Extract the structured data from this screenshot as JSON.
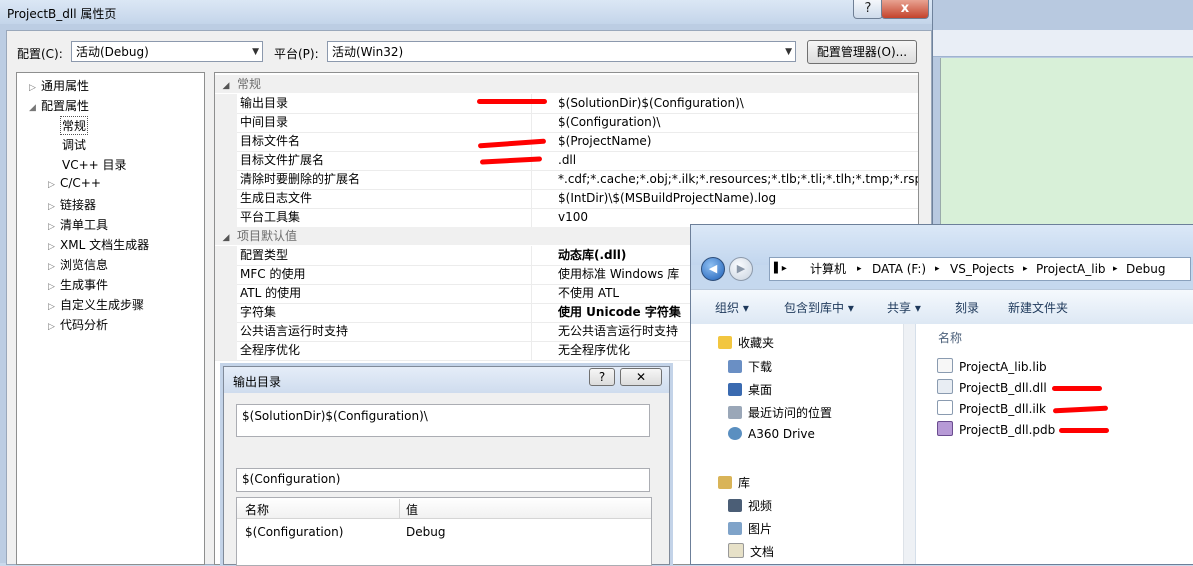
{
  "window": {
    "title": "ProjectB_dll 属性页",
    "help_btn": "?",
    "close_btn": "x"
  },
  "top": {
    "config_label": "配置(C):",
    "config_value": "活动(Debug)",
    "platform_label": "平台(P):",
    "platform_value": "活动(Win32)",
    "config_manager": "配置管理器(O)..."
  },
  "tree": [
    {
      "label": "通用属性",
      "expander": "▷"
    },
    {
      "label": "配置属性",
      "expander": "◢"
    },
    {
      "label": "常规",
      "expander": ""
    },
    {
      "label": "调试",
      "expander": ""
    },
    {
      "label": "VC++ 目录",
      "expander": ""
    },
    {
      "label": "C/C++",
      "expander": "▷"
    },
    {
      "label": "链接器",
      "expander": "▷"
    },
    {
      "label": "清单工具",
      "expander": "▷"
    },
    {
      "label": "XML 文档生成器",
      "expander": "▷"
    },
    {
      "label": "浏览信息",
      "expander": "▷"
    },
    {
      "label": "生成事件",
      "expander": "▷"
    },
    {
      "label": "自定义生成步骤",
      "expander": "▷"
    },
    {
      "label": "代码分析",
      "expander": "▷"
    }
  ],
  "grid": {
    "cat_general": "常规",
    "cat_defaults": "项目默认值",
    "expander": "◢",
    "general": [
      {
        "name": "输出目录",
        "value": "$(SolutionDir)$(Configuration)\\"
      },
      {
        "name": "中间目录",
        "value": "$(Configuration)\\"
      },
      {
        "name": "目标文件名",
        "value": "$(ProjectName)"
      },
      {
        "name": "目标文件扩展名",
        "value": ".dll"
      },
      {
        "name": "清除时要删除的扩展名",
        "value": "*.cdf;*.cache;*.obj;*.ilk;*.resources;*.tlb;*.tli;*.tlh;*.tmp;*.rsp;*.pgc"
      },
      {
        "name": "生成日志文件",
        "value": "$(IntDir)\\$(MSBuildProjectName).log"
      },
      {
        "name": "平台工具集",
        "value": "v100"
      }
    ],
    "defaults": [
      {
        "name": "配置类型",
        "value": "动态库(.dll)"
      },
      {
        "name": "MFC 的使用",
        "value": "使用标准 Windows 库"
      },
      {
        "name": "ATL 的使用",
        "value": "不使用 ATL"
      },
      {
        "name": "字符集",
        "value": "使用 Unicode 字符集"
      },
      {
        "name": "公共语言运行时支持",
        "value": "无公共语言运行时支持"
      },
      {
        "name": "全程序优化",
        "value": "无全程序优化"
      }
    ]
  },
  "subdialog": {
    "title": "输出目录",
    "help_btn": "?",
    "close_btn": "✕",
    "edit_value": "$(SolutionDir)$(Configuration)\\",
    "evaluated": "$(Configuration)",
    "col_name": "名称",
    "col_value": "值",
    "row_name": "$(Configuration)",
    "row_value": "Debug"
  },
  "explorer": {
    "back": "◀",
    "forward": "▶",
    "breadcrumb": [
      "计算机",
      "DATA (F:)",
      "VS_Pojects",
      "ProjectA_lib",
      "Debug"
    ],
    "crumb_sep": "▸",
    "toolbar": [
      "组织 ▾",
      "包含到库中 ▾",
      "共享 ▾",
      "刻录",
      "新建文件夹"
    ],
    "nav": {
      "favorites": "收藏夹",
      "fav_items": [
        "下载",
        "桌面",
        "最近访问的位置",
        "A360 Drive"
      ],
      "libraries": "库",
      "lib_items": [
        "视频",
        "图片",
        "文档"
      ]
    },
    "col_name": "名称",
    "files": [
      "ProjectA_lib.lib",
      "ProjectB_dll.dll",
      "ProjectB_dll.ilk",
      "ProjectB_dll.pdb"
    ]
  },
  "colors": {
    "annotation_red": "#ff0000",
    "title_bar": "#c4d5ea"
  }
}
